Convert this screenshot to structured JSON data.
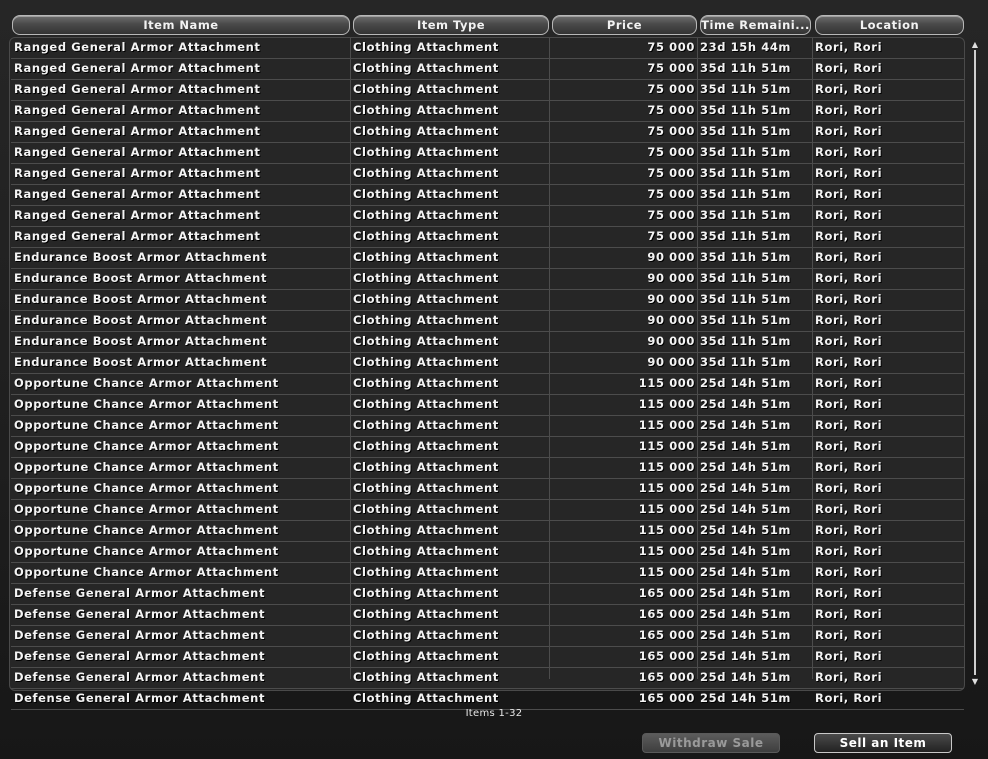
{
  "columns": {
    "name": "Item Name",
    "type": "Item Type",
    "price": "Price",
    "time": "Time Remaini...",
    "location": "Location"
  },
  "rows": [
    [
      "Ranged General Armor Attachment",
      "Clothing Attachment",
      "75 000",
      "23d 15h 44m",
      "Rori, Rori"
    ],
    [
      "Ranged General Armor Attachment",
      "Clothing Attachment",
      "75 000",
      "35d 11h 51m",
      "Rori, Rori"
    ],
    [
      "Ranged General Armor Attachment",
      "Clothing Attachment",
      "75 000",
      "35d 11h 51m",
      "Rori, Rori"
    ],
    [
      "Ranged General Armor Attachment",
      "Clothing Attachment",
      "75 000",
      "35d 11h 51m",
      "Rori, Rori"
    ],
    [
      "Ranged General Armor Attachment",
      "Clothing Attachment",
      "75 000",
      "35d 11h 51m",
      "Rori, Rori"
    ],
    [
      "Ranged General Armor Attachment",
      "Clothing Attachment",
      "75 000",
      "35d 11h 51m",
      "Rori, Rori"
    ],
    [
      "Ranged General Armor Attachment",
      "Clothing Attachment",
      "75 000",
      "35d 11h 51m",
      "Rori, Rori"
    ],
    [
      "Ranged General Armor Attachment",
      "Clothing Attachment",
      "75 000",
      "35d 11h 51m",
      "Rori, Rori"
    ],
    [
      "Ranged General Armor Attachment",
      "Clothing Attachment",
      "75 000",
      "35d 11h 51m",
      "Rori, Rori"
    ],
    [
      "Ranged General Armor Attachment",
      "Clothing Attachment",
      "75 000",
      "35d 11h 51m",
      "Rori, Rori"
    ],
    [
      "Endurance Boost Armor Attachment",
      "Clothing Attachment",
      "90 000",
      "35d 11h 51m",
      "Rori, Rori"
    ],
    [
      "Endurance Boost Armor Attachment",
      "Clothing Attachment",
      "90 000",
      "35d 11h 51m",
      "Rori, Rori"
    ],
    [
      "Endurance Boost Armor Attachment",
      "Clothing Attachment",
      "90 000",
      "35d 11h 51m",
      "Rori, Rori"
    ],
    [
      "Endurance Boost Armor Attachment",
      "Clothing Attachment",
      "90 000",
      "35d 11h 51m",
      "Rori, Rori"
    ],
    [
      "Endurance Boost Armor Attachment",
      "Clothing Attachment",
      "90 000",
      "35d 11h 51m",
      "Rori, Rori"
    ],
    [
      "Endurance Boost Armor Attachment",
      "Clothing Attachment",
      "90 000",
      "35d 11h 51m",
      "Rori, Rori"
    ],
    [
      "Opportune Chance Armor Attachment",
      "Clothing Attachment",
      "115 000",
      "25d 14h 51m",
      "Rori, Rori"
    ],
    [
      "Opportune Chance Armor Attachment",
      "Clothing Attachment",
      "115 000",
      "25d 14h 51m",
      "Rori, Rori"
    ],
    [
      "Opportune Chance Armor Attachment",
      "Clothing Attachment",
      "115 000",
      "25d 14h 51m",
      "Rori, Rori"
    ],
    [
      "Opportune Chance Armor Attachment",
      "Clothing Attachment",
      "115 000",
      "25d 14h 51m",
      "Rori, Rori"
    ],
    [
      "Opportune Chance Armor Attachment",
      "Clothing Attachment",
      "115 000",
      "25d 14h 51m",
      "Rori, Rori"
    ],
    [
      "Opportune Chance Armor Attachment",
      "Clothing Attachment",
      "115 000",
      "25d 14h 51m",
      "Rori, Rori"
    ],
    [
      "Opportune Chance Armor Attachment",
      "Clothing Attachment",
      "115 000",
      "25d 14h 51m",
      "Rori, Rori"
    ],
    [
      "Opportune Chance Armor Attachment",
      "Clothing Attachment",
      "115 000",
      "25d 14h 51m",
      "Rori, Rori"
    ],
    [
      "Opportune Chance Armor Attachment",
      "Clothing Attachment",
      "115 000",
      "25d 14h 51m",
      "Rori, Rori"
    ],
    [
      "Opportune Chance Armor Attachment",
      "Clothing Attachment",
      "115 000",
      "25d 14h 51m",
      "Rori, Rori"
    ],
    [
      "Defense General Armor Attachment",
      "Clothing Attachment",
      "165 000",
      "25d 14h 51m",
      "Rori, Rori"
    ],
    [
      "Defense General Armor Attachment",
      "Clothing Attachment",
      "165 000",
      "25d 14h 51m",
      "Rori, Rori"
    ],
    [
      "Defense General Armor Attachment",
      "Clothing Attachment",
      "165 000",
      "25d 14h 51m",
      "Rori, Rori"
    ],
    [
      "Defense General Armor Attachment",
      "Clothing Attachment",
      "165 000",
      "25d 14h 51m",
      "Rori, Rori"
    ],
    [
      "Defense General Armor Attachment",
      "Clothing Attachment",
      "165 000",
      "25d 14h 51m",
      "Rori, Rori"
    ],
    [
      "Defense General Armor Attachment",
      "Clothing Attachment",
      "165 000",
      "25d 14h 51m",
      "Rori, Rori"
    ]
  ],
  "footer": {
    "items_count": "Items 1-32",
    "withdraw_label": "Withdraw Sale",
    "sell_label": "Sell an Item"
  },
  "scrollbar": {
    "up_icon": "arrow-up-icon",
    "down_icon": "arrow-down-icon"
  }
}
